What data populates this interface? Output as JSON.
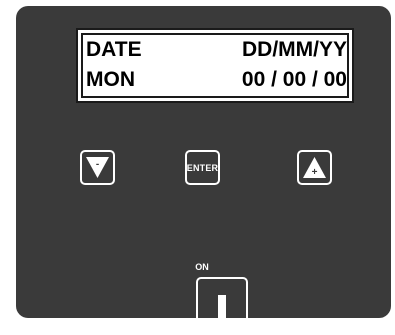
{
  "display": {
    "row1": {
      "left": "DATE",
      "right": "DD/MM/YY"
    },
    "row2": {
      "left": "MON",
      "right": "00 / 00 / 00"
    }
  },
  "buttons": {
    "down": {
      "icon": "down-triangle-minus-icon",
      "symbol": "-"
    },
    "enter": {
      "label": "ENTER"
    },
    "up": {
      "icon": "up-triangle-plus-icon",
      "symbol": "+"
    }
  },
  "power": {
    "label": "ON",
    "icon": "power-switch-icon"
  },
  "colors": {
    "panel": "#3a3a3a",
    "lcd_background": "#ffffff",
    "button_outline": "#ffffff"
  }
}
